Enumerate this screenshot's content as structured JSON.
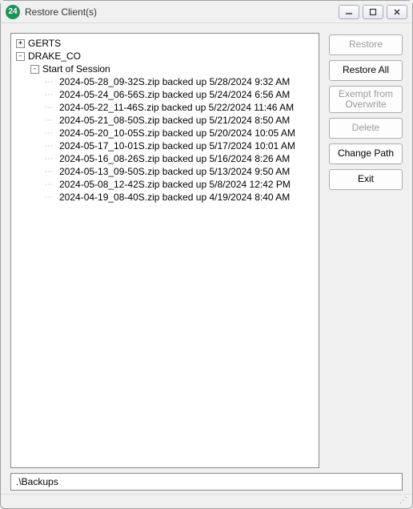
{
  "window": {
    "icon_text": "24",
    "title": "Restore Client(s)"
  },
  "tree": {
    "nodes": [
      {
        "level": 0,
        "expander": "+",
        "label": "GERTS"
      },
      {
        "level": 0,
        "expander": "-",
        "label": "DRAKE_CO"
      },
      {
        "level": 1,
        "expander": "-",
        "label": "Start of Session"
      },
      {
        "level": 2,
        "expander": "",
        "label": "2024-05-28_09-32S.zip backed up 5/28/2024 9:32 AM"
      },
      {
        "level": 2,
        "expander": "",
        "label": "2024-05-24_06-56S.zip backed up 5/24/2024 6:56 AM"
      },
      {
        "level": 2,
        "expander": "",
        "label": "2024-05-22_11-46S.zip backed up 5/22/2024 11:46 AM"
      },
      {
        "level": 2,
        "expander": "",
        "label": "2024-05-21_08-50S.zip backed up 5/21/2024 8:50 AM"
      },
      {
        "level": 2,
        "expander": "",
        "label": "2024-05-20_10-05S.zip backed up 5/20/2024 10:05 AM"
      },
      {
        "level": 2,
        "expander": "",
        "label": "2024-05-17_10-01S.zip backed up 5/17/2024 10:01 AM"
      },
      {
        "level": 2,
        "expander": "",
        "label": "2024-05-16_08-26S.zip backed up 5/16/2024 8:26 AM"
      },
      {
        "level": 2,
        "expander": "",
        "label": "2024-05-13_09-50S.zip backed up 5/13/2024 9:50 AM"
      },
      {
        "level": 2,
        "expander": "",
        "label": "2024-05-08_12-42S.zip backed up 5/8/2024 12:42 PM"
      },
      {
        "level": 2,
        "expander": "",
        "label": "2024-04-19_08-40S.zip backed up 4/19/2024 8:40 AM"
      }
    ]
  },
  "buttons": {
    "restore": {
      "label": "Restore",
      "enabled": false,
      "tall": false
    },
    "restore_all": {
      "label": "Restore All",
      "enabled": true,
      "tall": false
    },
    "exempt": {
      "label": "Exempt from Overwrite",
      "enabled": false,
      "tall": true
    },
    "delete": {
      "label": "Delete",
      "enabled": false,
      "tall": false
    },
    "change_path": {
      "label": "Change Path",
      "enabled": true,
      "tall": false
    },
    "exit": {
      "label": "Exit",
      "enabled": true,
      "tall": false
    }
  },
  "path": ".\\Backups"
}
